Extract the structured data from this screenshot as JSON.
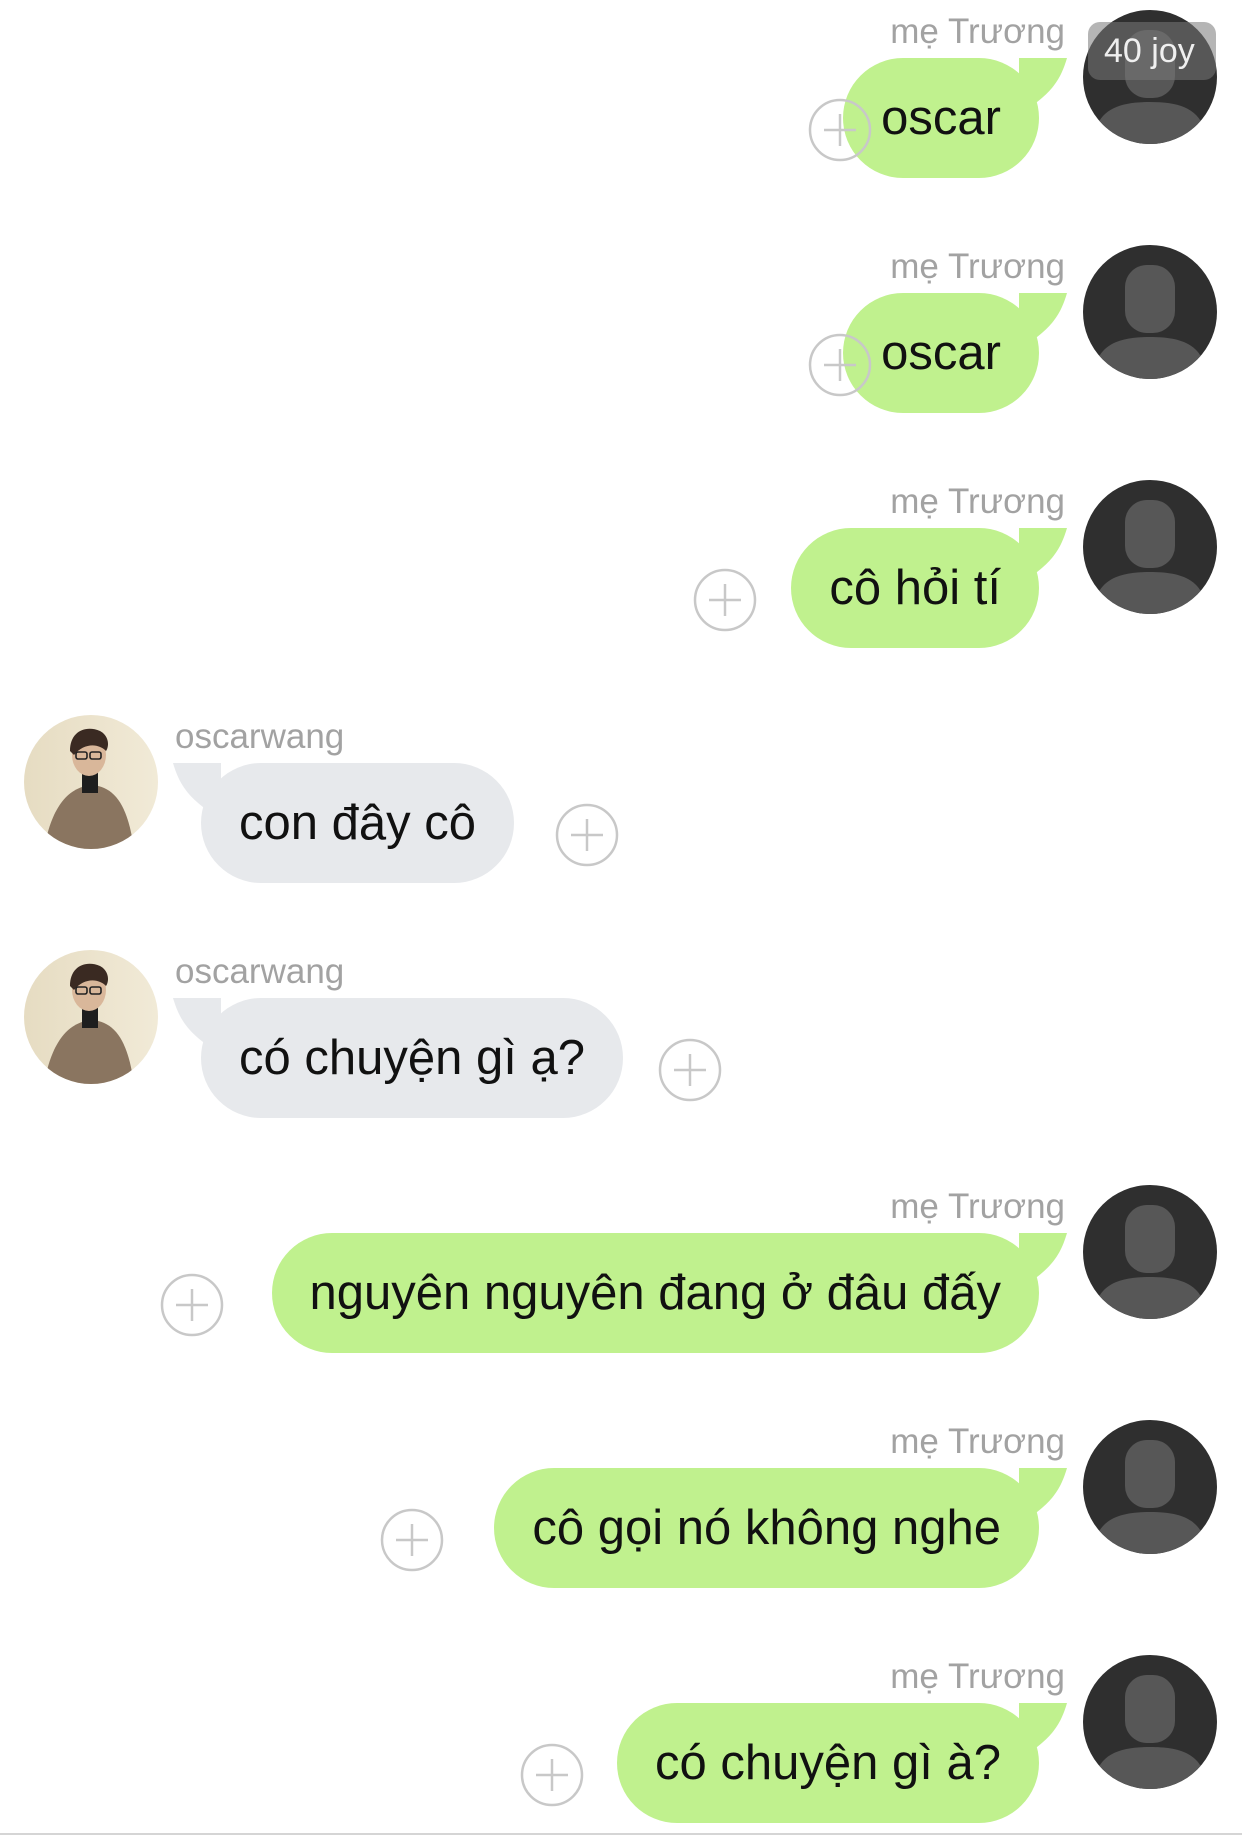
{
  "messages": [
    {
      "direction": "out",
      "sender": "mẹ Trương",
      "text": "oscar"
    },
    {
      "direction": "out",
      "sender": "mẹ Trương",
      "text": "oscar"
    },
    {
      "direction": "out",
      "sender": "mẹ Trương",
      "text": "cô hỏi tí"
    },
    {
      "direction": "in",
      "sender": "oscarwang",
      "text": "con đây cô"
    },
    {
      "direction": "in",
      "sender": "oscarwang",
      "text": "có chuyện gì ạ?"
    },
    {
      "direction": "out",
      "sender": "mẹ Trương",
      "text": "nguyên nguyên đang ở đâu đấy"
    },
    {
      "direction": "out",
      "sender": "mẹ Trương",
      "text": "cô gọi nó không nghe"
    },
    {
      "direction": "out",
      "sender": "mẹ Trương",
      "text": "có chuyện gì à?"
    }
  ],
  "overlay_badge": "40 joy",
  "colors": {
    "outgoing_bubble": "#c0f18e",
    "incoming_bubble": "#e7e9ec",
    "sender_name": "#a2a2a2",
    "avatar_default_bg": "#2f2f2f"
  },
  "icons": {
    "add_reaction": "plus-circle-icon",
    "default_avatar": "person-silhouette-icon"
  }
}
